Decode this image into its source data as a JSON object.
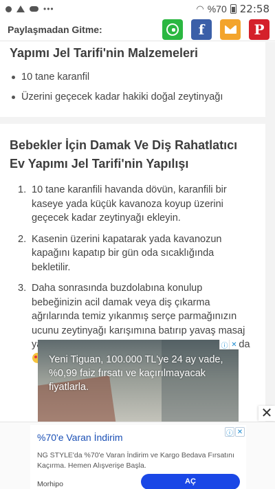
{
  "status_bar": {
    "battery_text": "%70",
    "time": "22:58",
    "more_dots": "•••"
  },
  "share_bar": {
    "label": "Paylaşmadan Gitme:",
    "buttons": [
      {
        "name": "whatsapp",
        "color": "#2bb741"
      },
      {
        "name": "facebook",
        "glyph": "f",
        "color": "#3b5fa8"
      },
      {
        "name": "mail",
        "color": "#f3a42c"
      },
      {
        "name": "pinterest",
        "glyph": "P",
        "color": "#d4202a"
      }
    ]
  },
  "ingredients": {
    "title": "Yapımı Jel Tarifi'nin Malzemeleri",
    "items": [
      "10 tane karanfil",
      "Üzerini geçecek kadar hakiki doğal zeytinyağı"
    ]
  },
  "recipe": {
    "title": "Bebekler İçin Damak Ve Diş Rahatlatıcı Ev Yapımı Jel Tarifi'nin Yapılışı",
    "steps": [
      {
        "num": "1.",
        "text": "10 tane karanfili havanda dövün, karanfili bir kaseye yada küçük kavanoza koyup üzerini geçecek kadar zeytinyağı ekleyin."
      },
      {
        "num": "2.",
        "text": "Kasenin üzerini kapatarak yada kavanozun kapağını kapatıp bir gün oda sıcaklığında bekletilir."
      },
      {
        "num": "3.",
        "text": "Daha sonrasında buzdolabına konulup bebeğinizin acil damak veya diş çıkarma ağrılarında temiz yıkanmış serçe parmağınızın ucunu zeytinyağı karışımına batırıp yavaş masaj yaparak sürün. Uykusuz ve ağrılı gecelere elveda"
      }
    ]
  },
  "video_ad": {
    "headline": "Yeni Tiguan, 100.000 TL'ye 24 ay vade, %0,99 faiz fırsatı ve kaçırılmayacak fiyatlarla."
  },
  "close_label": "✕",
  "bottom_ad": {
    "title": "%70'e Varan İndirim",
    "description": "NG STYLE'da %70'e Varan İndirim ve Kargo Bedava Fırsatını Kaçırma. Hemen Alışverişe Başla.",
    "brand": "Morhipo",
    "cta": "AÇ"
  }
}
